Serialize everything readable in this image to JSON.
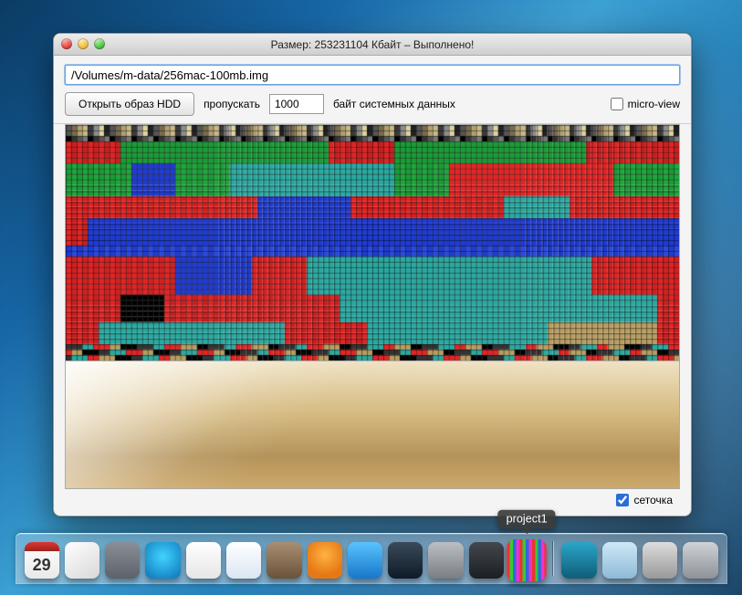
{
  "window": {
    "title": "Размер: 253231104 Кбайт  – Выполнено!",
    "path": "/Volumes/m-data/256mac-100mb.img",
    "open_btn": "Открыть образ HDD",
    "skip_label": "пропускать",
    "skip_value": "1000",
    "skip_suffix": "байт системных данных",
    "microview_label": "micro-view",
    "microview_checked": false,
    "grid_label": "сеточка",
    "grid_checked": true
  },
  "dock": {
    "hovered_label": "project1",
    "calendar_day": "29",
    "items": [
      {
        "name": "calendar",
        "kind": "di-cal"
      },
      {
        "name": "textedit",
        "kind": "di-paper"
      },
      {
        "name": "calculator",
        "kind": "di-grid"
      },
      {
        "name": "itunes",
        "kind": "di-itunes"
      },
      {
        "name": "libreoffice",
        "kind": "di-libre"
      },
      {
        "name": "document",
        "kind": "di-doc"
      },
      {
        "name": "gimp",
        "kind": "di-gimp"
      },
      {
        "name": "vlc",
        "kind": "di-vlc"
      },
      {
        "name": "blueapp",
        "kind": "di-blue"
      },
      {
        "name": "utility",
        "kind": "di-tool"
      },
      {
        "name": "system-preferences",
        "kind": "di-pref"
      },
      {
        "name": "dashboard",
        "kind": "di-dash"
      },
      {
        "name": "project1",
        "kind": "di-pixels",
        "label": true
      },
      {
        "name": "separator",
        "sep": true
      },
      {
        "name": "pictures-stack",
        "kind": "di-teal"
      },
      {
        "name": "downloads-folder",
        "kind": "di-folder"
      },
      {
        "name": "finder-stack",
        "kind": "di-osx"
      },
      {
        "name": "trash",
        "kind": "di-trash"
      }
    ]
  },
  "viz": {
    "cols": 112,
    "rows": 43,
    "bands": [
      {
        "rows": [
          0,
          2
        ],
        "palette": [
          "#555",
          "#7a6b4c",
          "#b0a070",
          "#cab884",
          "#3a3a3a",
          "#8c8c8c",
          "#ded2a0",
          "#222"
        ]
      },
      {
        "rows": [
          2,
          3
        ],
        "palette": [
          "#000",
          "#333",
          "#555",
          "#777"
        ]
      },
      {
        "rows": [
          3,
          7
        ],
        "palette": [
          "#e32424",
          "#c91f1f"
        ],
        "stripes": [
          [
            "#1a9b36",
            10,
            48
          ],
          [
            "#1a9b36",
            60,
            95
          ]
        ]
      },
      {
        "rows": [
          7,
          13
        ],
        "palette": [
          "#1a9b36",
          "#20a63c"
        ],
        "stripes": [
          [
            "#2aa8a0",
            30,
            60
          ],
          [
            "#e32424",
            70,
            100
          ],
          [
            "#1f3bd0",
            12,
            20
          ]
        ]
      },
      {
        "rows": [
          13,
          17
        ],
        "palette": [
          "#e32424",
          "#d22020"
        ],
        "stripes": [
          [
            "#1f3bd0",
            35,
            52
          ],
          [
            "#2aa8a0",
            80,
            92
          ]
        ]
      },
      {
        "rows": [
          17,
          22
        ],
        "palette": [
          "#e32424",
          "#c91f1f"
        ],
        "stripes": [
          [
            "#1f3bd0",
            4,
            112
          ]
        ]
      },
      {
        "rows": [
          22,
          24
        ],
        "palette": [
          "#1f3bd0",
          "#2b4ae0"
        ]
      },
      {
        "rows": [
          24,
          31
        ],
        "palette": [
          "#e32424",
          "#d22020"
        ],
        "stripes": [
          [
            "#2aa8a0",
            44,
            96
          ],
          [
            "#1f3bd0",
            20,
            34
          ]
        ]
      },
      {
        "rows": [
          31,
          36
        ],
        "palette": [
          "#e32424",
          "#c91f1f"
        ],
        "stripes": [
          [
            "#2aa8a0",
            50,
            108
          ],
          [
            "#000",
            10,
            18
          ]
        ]
      },
      {
        "rows": [
          36,
          40
        ],
        "palette": [
          "#e32424",
          "#c91f1f"
        ],
        "stripes": [
          [
            "#2aa8a0",
            6,
            40
          ],
          [
            "#2aa8a0",
            55,
            100
          ],
          [
            "#b79c60",
            88,
            108
          ]
        ]
      },
      {
        "rows": [
          40,
          43
        ],
        "palette": [
          "#b79c60",
          "#000",
          "#333",
          "#2aa8a0",
          "#e32424"
        ]
      }
    ]
  }
}
